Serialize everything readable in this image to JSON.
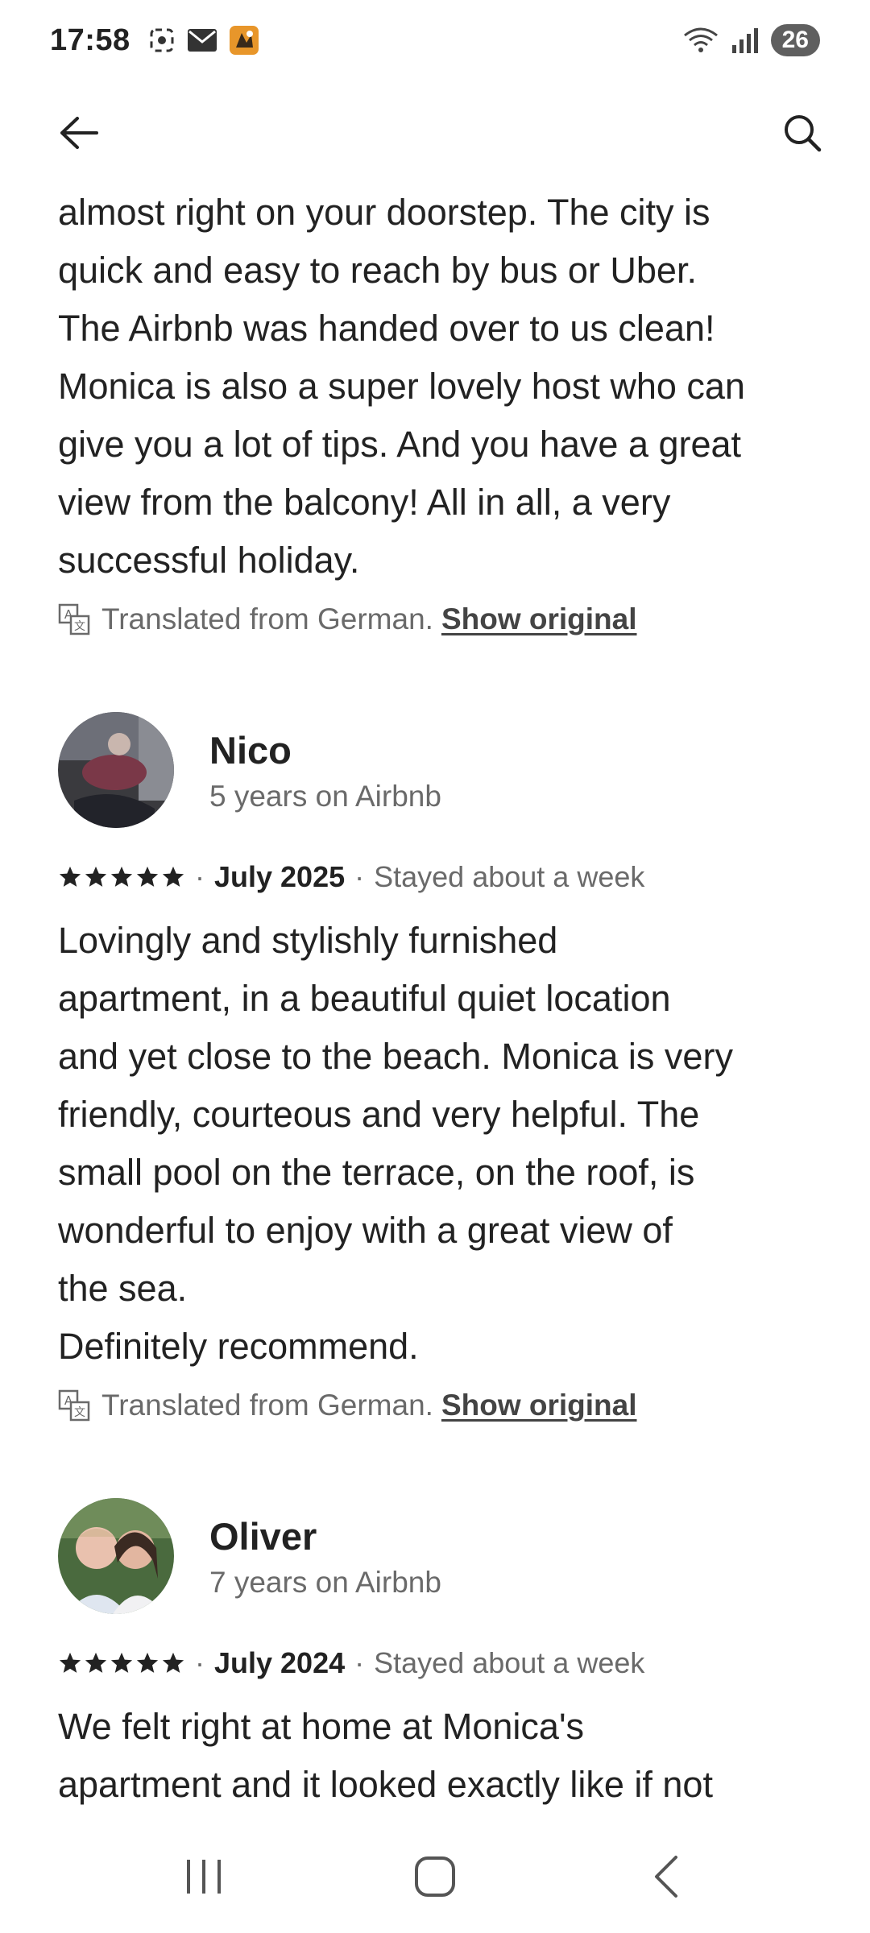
{
  "status_bar": {
    "time": "17:58",
    "battery": "26",
    "icons": [
      "screenshot-icon",
      "mail-icon",
      "app-notification-icon",
      "wifi-icon",
      "signal-icon"
    ]
  },
  "app_bar": {
    "back_icon": "arrow-left-icon",
    "search_icon": "search-icon"
  },
  "reviews": [
    {
      "text": "almost right on your doorstep. The city is\nquick and easy to reach by bus or Uber.\nThe Airbnb was handed over to us clean!\nMonica is also a super lovely host who can\ngive you a lot of tips. And you have a great\nview from the balcony! All in all, a very\nsuccessful holiday.",
      "translated_label": "Translated from German.",
      "show_original": "Show original"
    },
    {
      "name": "Nico",
      "tenure": "5 years on Airbnb",
      "rating": 5,
      "date": "July 2025",
      "stay": "Stayed about a week",
      "text": "Lovingly and stylishly furnished\napartment, in a beautiful quiet location\nand yet close to the beach. Monica is very\nfriendly, courteous and very helpful. The\nsmall pool on the terrace, on the roof, is\nwonderful to enjoy with a great view of\nthe sea.\nDefinitely recommend.",
      "translated_label": "Translated from German.",
      "show_original": "Show original"
    },
    {
      "name": "Oliver",
      "tenure": "7 years on Airbnb",
      "rating": 5,
      "date": "July 2024",
      "stay": "Stayed about a week",
      "text": "We felt right at home at Monica's\napartment and it looked exactly like if not"
    }
  ],
  "colors": {
    "text_primary": "#222222",
    "text_secondary": "#6a6a6a",
    "battery_bg": "#5f5f5f"
  }
}
